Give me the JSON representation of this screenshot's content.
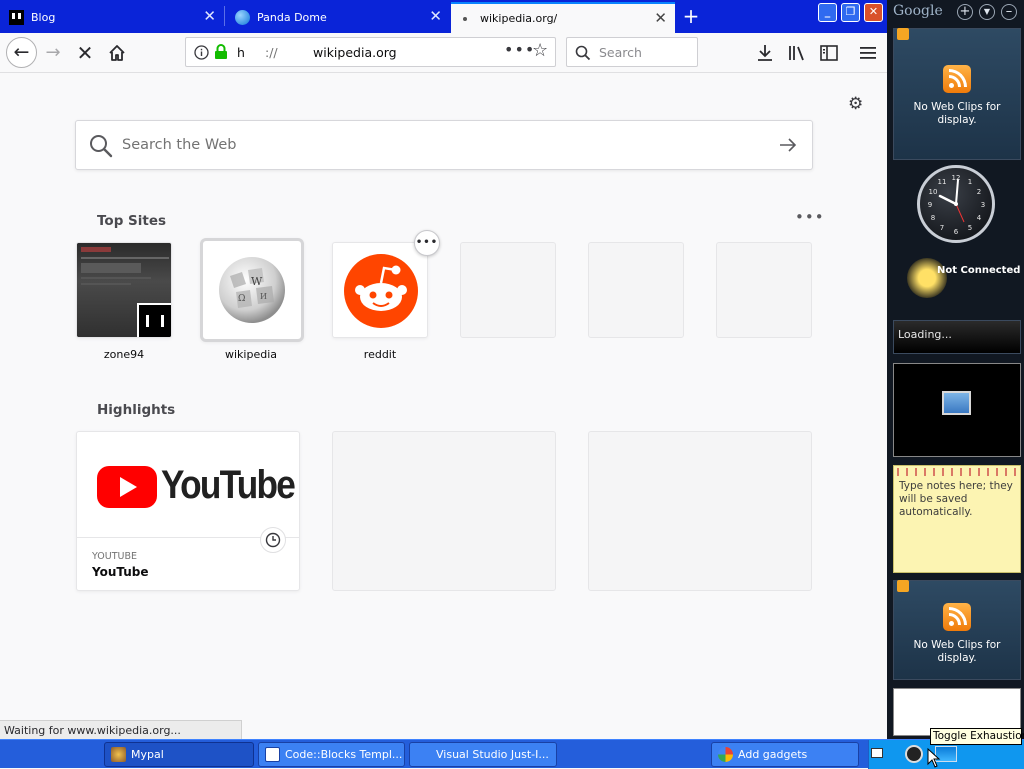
{
  "browser": {
    "tabs": [
      {
        "label": "Blog",
        "active": false
      },
      {
        "label": "Panda Dome",
        "active": false
      },
      {
        "label": "wikipedia.org/",
        "active": true
      }
    ],
    "url": {
      "scheme": "h",
      "sep": "://",
      "host": "wikipedia.org"
    },
    "search_placeholder": "Search",
    "ntp_search_placeholder": "Search the Web",
    "top_sites_title": "Top Sites",
    "top_sites": [
      {
        "label": "zone94"
      },
      {
        "label": "wikipedia"
      },
      {
        "label": "reddit"
      }
    ],
    "highlights_title": "Highlights",
    "highlights": [
      {
        "logo_text": "YouTube",
        "source": "YOUTUBE",
        "title": "YouTube"
      }
    ],
    "status_text": "Waiting for www.wikipedia.org...",
    "colors": {
      "youtube_red": "#ff0000",
      "reddit_orange": "#ff4500",
      "accent": "#0a84ff"
    }
  },
  "taskbar": {
    "items": [
      {
        "label": "Mypal"
      },
      {
        "label": "Code::Blocks Templ..."
      },
      {
        "label": "Visual Studio Just-I..."
      },
      {
        "label": "Add gadgets"
      }
    ]
  },
  "sidebar": {
    "title": "Google",
    "rss_message": "No Web Clips for display.",
    "weather_status": "Not Connected",
    "loading_text": "Loading...",
    "notes_text": "Type notes here; they will be saved automatically.",
    "rss_message_2": "No Web Clips for display."
  },
  "tooltip": {
    "text": "Toggle Exhaustion"
  }
}
